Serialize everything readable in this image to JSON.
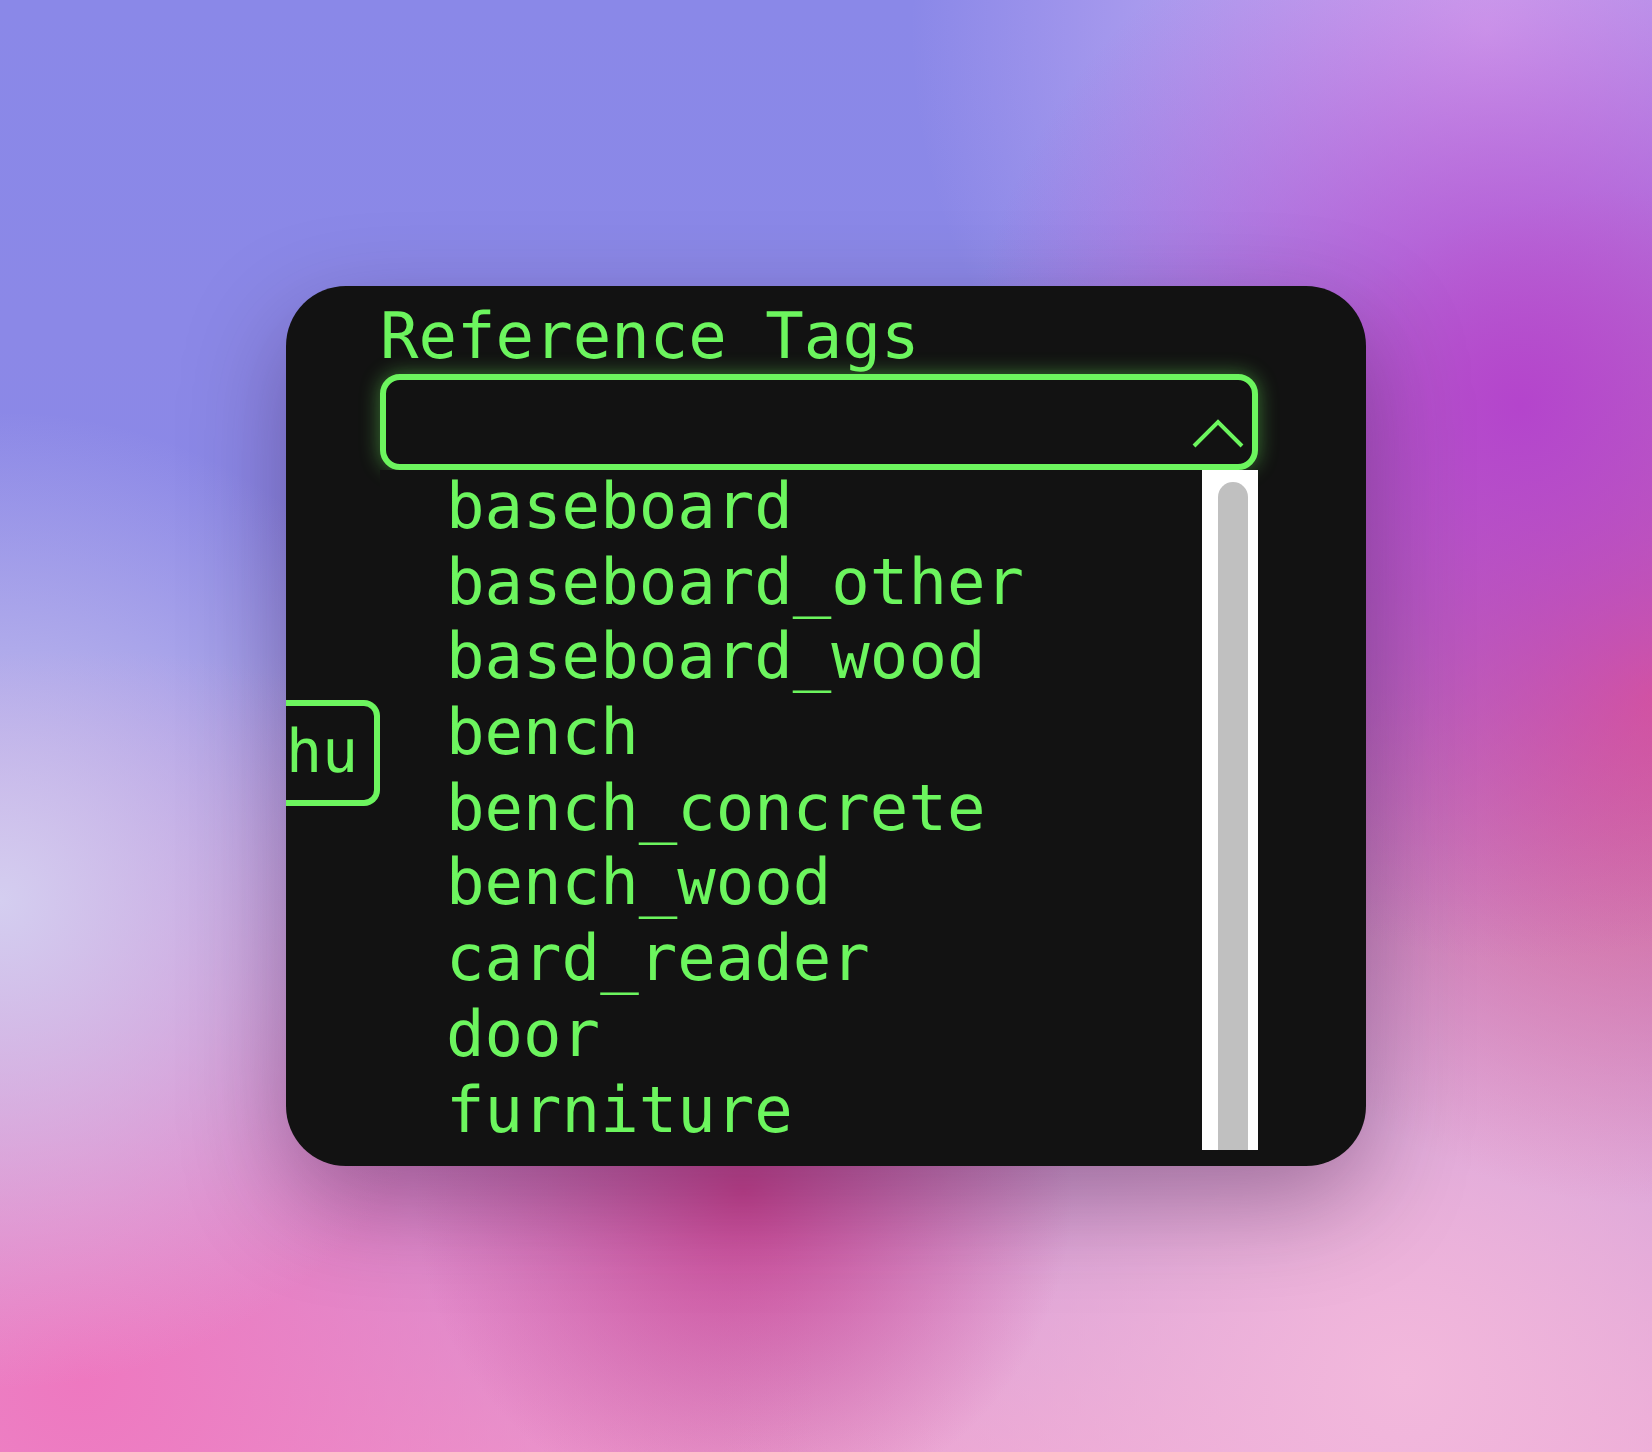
{
  "side_tag": {
    "text": "hu"
  },
  "dropdown": {
    "label": "Reference Tags",
    "expanded": true,
    "options": [
      {
        "label": "baseboard",
        "selected": false
      },
      {
        "label": "baseboard_other",
        "selected": false
      },
      {
        "label": "baseboard_wood",
        "selected": false
      },
      {
        "label": "bench",
        "selected": false
      },
      {
        "label": "bench_concrete",
        "selected": false
      },
      {
        "label": "bench_wood",
        "selected": false
      },
      {
        "label": "card_reader",
        "selected": false
      },
      {
        "label": "door",
        "selected": false
      },
      {
        "label": "furniture",
        "selected": false
      }
    ]
  }
}
